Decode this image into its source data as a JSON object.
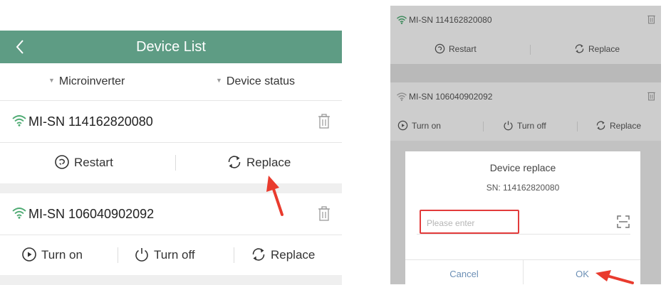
{
  "colors": {
    "header_bg": "#5e9c84",
    "wifi": "#4daa72",
    "arrow": "#e93b2e",
    "highlight_box": "#e23b3b"
  },
  "left": {
    "title": "Device List",
    "filters": [
      "Microinverter",
      "Device status"
    ],
    "devices": [
      {
        "sn": "MI-SN  114162820080",
        "actions": [
          "Restart",
          "Replace"
        ]
      },
      {
        "sn": "MI-SN  106040902092",
        "actions": [
          "Turn on",
          "Turn off",
          "Replace"
        ]
      }
    ]
  },
  "right": {
    "devices": [
      {
        "sn": "MI-SN  114162820080",
        "actions": [
          "Restart",
          "Replace"
        ]
      },
      {
        "sn": "MI-SN  106040902092",
        "actions": [
          "Turn on",
          "Turn off",
          "Replace"
        ]
      }
    ],
    "dialog": {
      "title": "Device replace",
      "sn_label": "SN:  114162820080",
      "input_placeholder": "Please enter",
      "cancel": "Cancel",
      "ok": "OK"
    }
  }
}
